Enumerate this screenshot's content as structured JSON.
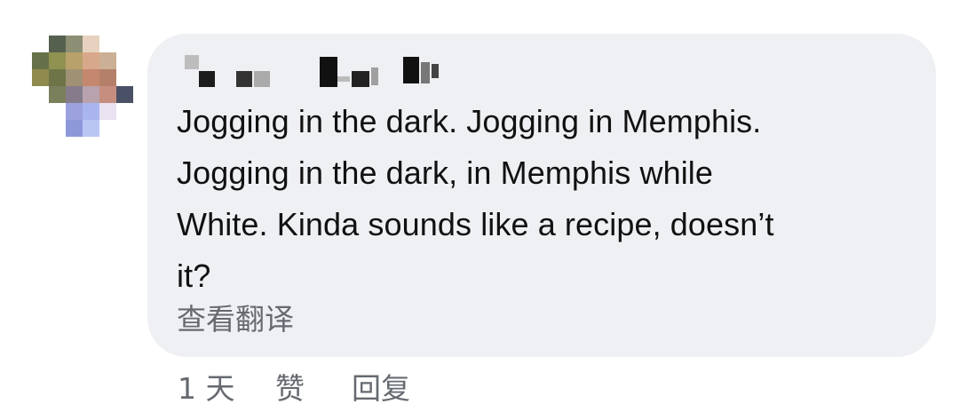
{
  "comment": {
    "author_name": "",
    "text_lines": [
      "Jogging in the dark. Jogging in Memphis.",
      "Jogging in the dark, in Memphis while",
      "White.  Kinda sounds like a recipe, doesn’t",
      "it?"
    ],
    "translate_label": "查看翻译",
    "time_ago": "1 天",
    "like_label": "赞",
    "reply_label": "回复"
  },
  "colors": {
    "bubble_background": "#eef0f3",
    "text": "#111111",
    "secondary_text": "#666a70"
  },
  "icons": {
    "avatar": "pixelated-avatar",
    "author_name": "pixelated-name"
  }
}
